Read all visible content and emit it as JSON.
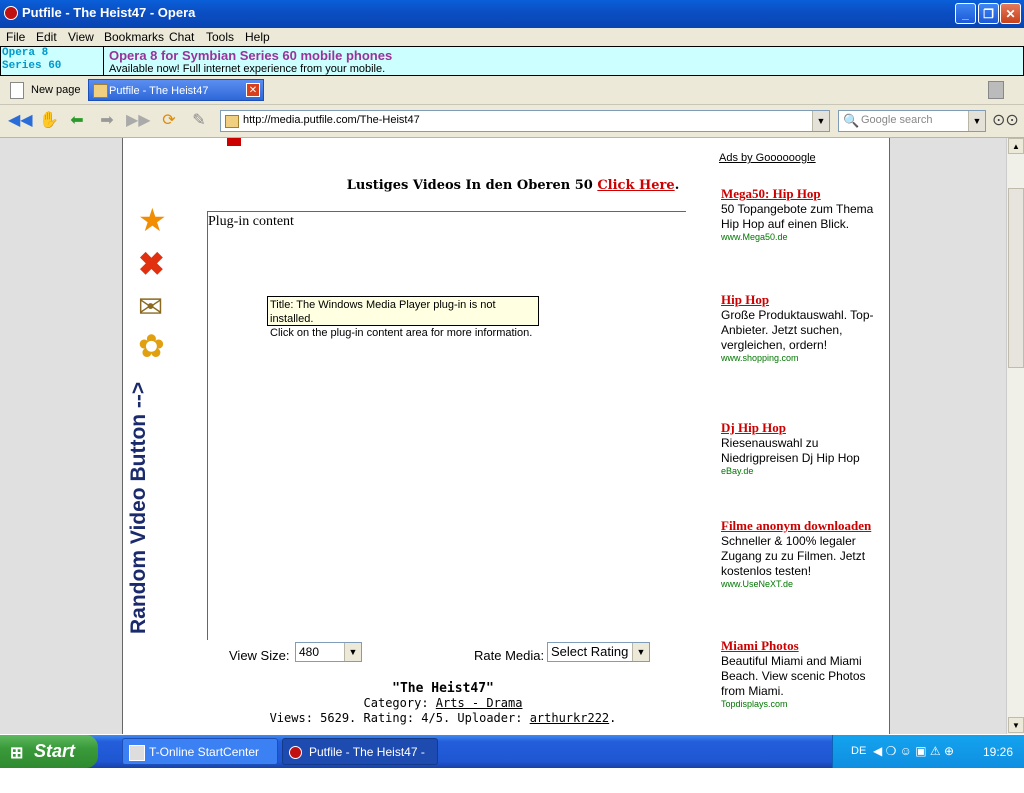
{
  "window": {
    "title": "Putfile - The Heist47 - Opera"
  },
  "menu": [
    "File",
    "Edit",
    "View",
    "Bookmarks",
    "Chat",
    "Tools",
    "Help"
  ],
  "banner": {
    "left_line1": "Opera 8",
    "left_line2": "Series 60",
    "headline": "Opera 8 for Symbian Series 60 mobile phones",
    "subline": "Available now! Full internet experience from your mobile."
  },
  "tabs": {
    "new_page": "New page",
    "active": "Putfile - The Heist47"
  },
  "address": {
    "url": "http://media.putfile.com/The-Heist47",
    "search_placeholder": "Google search"
  },
  "content": {
    "promo_text": "Lustiges Videos In den Oberen 50",
    "promo_link": "Click Here",
    "promo_end": ".",
    "plugin_label": "Plug-in content",
    "tooltip_line1": "Title: The Windows Media Player plug-in is not installed.",
    "tooltip_line2": "Click on the plug-in content area for more information.",
    "random_button": "Random Video Button -->",
    "view_size_label": "View Size:",
    "view_size_value": "480",
    "rate_label": "Rate Media:",
    "rate_value": "Select Rating",
    "media_title": "\"The Heist47\"",
    "category_label": "Category:",
    "category_value": "Arts - Drama",
    "stats_text": "Views: 5629. Rating: 4/5. Uploader:",
    "uploader": "arthurkr222",
    "stats_end": "."
  },
  "ads": {
    "header": "Ads by Goooooogle",
    "items": [
      {
        "title": "Mega50: Hip Hop",
        "body": "50 Topangebote zum Thema Hip Hop auf einen Blick.",
        "url": "www.Mega50.de"
      },
      {
        "title": "Hip Hop",
        "body": "Große Produktauswahl. Top-Anbieter. Jetzt suchen, vergleichen, ordern!",
        "url": "www.shopping.com"
      },
      {
        "title": "Dj Hip Hop",
        "body": "Riesenauswahl zu Niedrigpreisen Dj Hip Hop",
        "url": "eBay.de"
      },
      {
        "title": "Filme anonym downloaden",
        "body": "Schneller & 100% legaler Zugang zu zu Filmen. Jetzt kostenlos testen!",
        "url": "www.UseNeXT.de"
      },
      {
        "title": "Miami Photos",
        "body": "Beautiful Miami and Miami Beach. View scenic Photos from Miami.",
        "url": "Topdisplays.com"
      }
    ]
  },
  "taskbar": {
    "start": "Start",
    "tasks": [
      "T-Online StartCenter",
      "Putfile - The Heist47 - ..."
    ],
    "lang": "DE",
    "clock": "19:26"
  }
}
